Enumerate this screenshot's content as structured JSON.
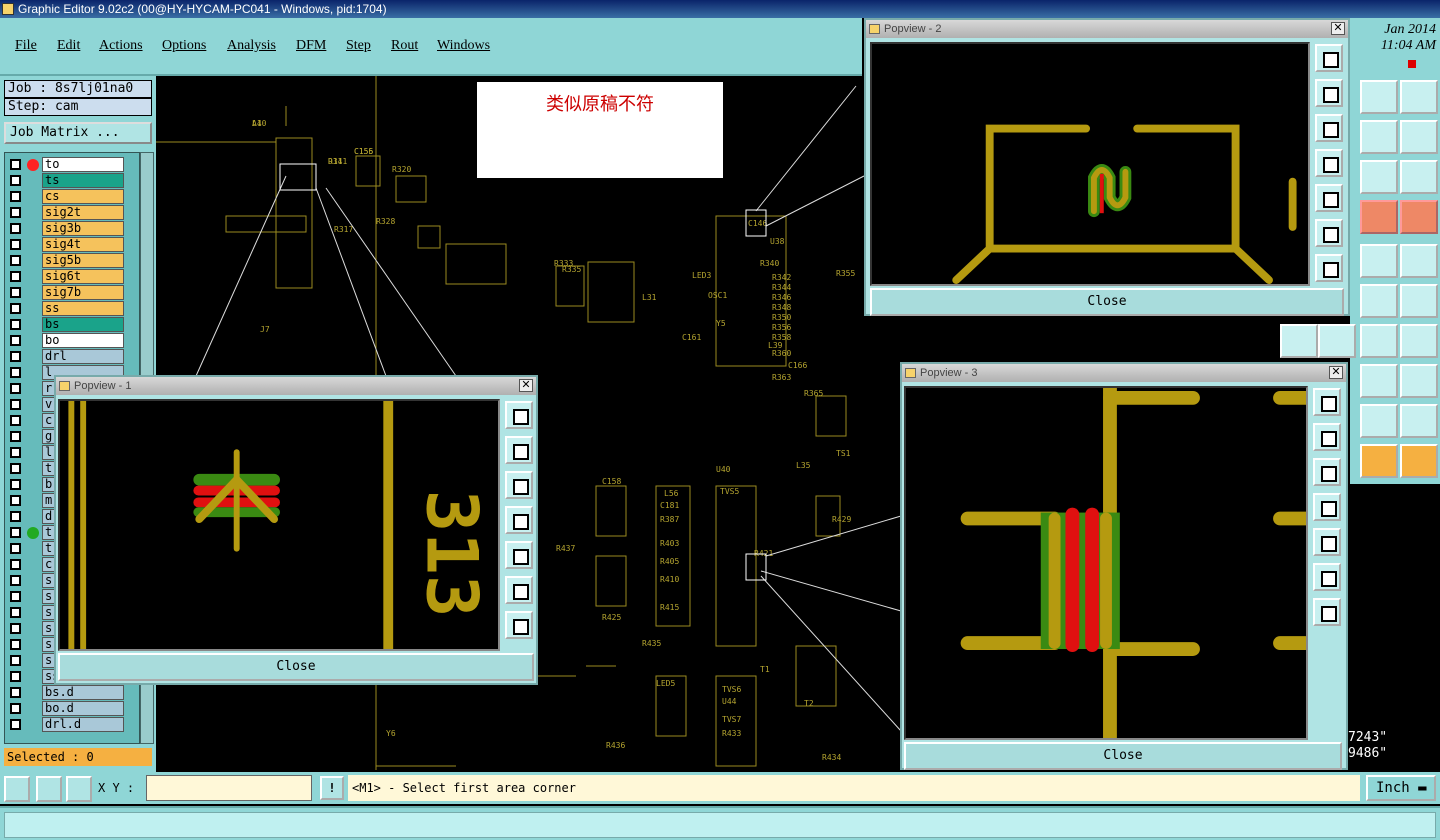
{
  "window": {
    "title": "Graphic Editor 9.02c2 (00@HY-HYCAM-PC041 - Windows, pid:1704)"
  },
  "menu": [
    "File",
    "Edit",
    "Actions",
    "Options",
    "Analysis",
    "DFM",
    "Step",
    "Rout",
    "Windows"
  ],
  "clock": {
    "date": "Jan 2014",
    "time": "11:04 AM"
  },
  "job": {
    "job_label": "Job : 8s7lj01na0",
    "step_label": "Step: cam",
    "matrix_button": "Job Matrix ..."
  },
  "layers": [
    {
      "name": "to",
      "color": "#ffffff",
      "dot": "#ff2222"
    },
    {
      "name": "ts",
      "color": "#1aa38a",
      "dot": ""
    },
    {
      "name": "cs",
      "color": "#f5c25c",
      "dot": ""
    },
    {
      "name": "sig2t",
      "color": "#f5c25c",
      "dot": ""
    },
    {
      "name": "sig3b",
      "color": "#f5c25c",
      "dot": ""
    },
    {
      "name": "sig4t",
      "color": "#f5c25c",
      "dot": ""
    },
    {
      "name": "sig5b",
      "color": "#f5c25c",
      "dot": ""
    },
    {
      "name": "sig6t",
      "color": "#f5c25c",
      "dot": ""
    },
    {
      "name": "sig7b",
      "color": "#f5c25c",
      "dot": ""
    },
    {
      "name": "ss",
      "color": "#f5c25c",
      "dot": ""
    },
    {
      "name": "bs",
      "color": "#1aa38a",
      "dot": ""
    },
    {
      "name": "bo",
      "color": "#ffffff",
      "dot": ""
    },
    {
      "name": "drl",
      "color": "#a9c8d8",
      "dot": ""
    },
    {
      "name": "l",
      "color": "#a9c8d8",
      "dot": ""
    },
    {
      "name": "r",
      "color": "#a9c8d8",
      "dot": ""
    },
    {
      "name": "v",
      "color": "#a9c8d8",
      "dot": ""
    },
    {
      "name": "c",
      "color": "#a9c8d8",
      "dot": ""
    },
    {
      "name": "g",
      "color": "#a9c8d8",
      "dot": ""
    },
    {
      "name": "l",
      "color": "#a9c8d8",
      "dot": ""
    },
    {
      "name": "t",
      "color": "#a9c8d8",
      "dot": ""
    },
    {
      "name": "b",
      "color": "#a9c8d8",
      "dot": ""
    },
    {
      "name": "m",
      "color": "#a9c8d8",
      "dot": ""
    },
    {
      "name": "d",
      "color": "#a9c8d8",
      "dot": ""
    },
    {
      "name": "t",
      "color": "#a9c8d8",
      "dot": "#22aa22"
    },
    {
      "name": "t",
      "color": "#a9c8d8",
      "dot": ""
    },
    {
      "name": "c",
      "color": "#a9c8d8",
      "dot": ""
    },
    {
      "name": "s",
      "color": "#a9c8d8",
      "dot": ""
    },
    {
      "name": "s",
      "color": "#a9c8d8",
      "dot": ""
    },
    {
      "name": "s",
      "color": "#a9c8d8",
      "dot": ""
    },
    {
      "name": "s",
      "color": "#a9c8d8",
      "dot": ""
    },
    {
      "name": "s",
      "color": "#a9c8d8",
      "dot": ""
    },
    {
      "name": "s",
      "color": "#a9c8d8",
      "dot": ""
    },
    {
      "name": "ss.d",
      "color": "#a9c8d8",
      "dot": ""
    },
    {
      "name": "bs.d",
      "color": "#a9c8d8",
      "dot": ""
    },
    {
      "name": "bo.d",
      "color": "#a9c8d8",
      "dot": ""
    },
    {
      "name": "drl.d",
      "color": "#a9c8d8",
      "dot": ""
    }
  ],
  "selected": "Selected : 0",
  "stamp": "类似原稿不符",
  "popviews": {
    "p1": {
      "title": "Popview - 1",
      "close": "Close",
      "silk_text": "313 L"
    },
    "p2": {
      "title": "Popview - 2",
      "close": "Close"
    },
    "p3": {
      "title": "Popview - 3",
      "close": "Close"
    }
  },
  "bottom": {
    "xy_label": "X Y :",
    "xy_value": "",
    "excl": "!",
    "prompt": "<M1> - Select first area corner",
    "units": "Inch"
  },
  "coords": {
    "line1": "7243\"",
    "line2": "9486\""
  },
  "pcb_labels": [
    "A1",
    "R311",
    "C155",
    "R317",
    "R320",
    "R328",
    "R333",
    "R335",
    "LED3",
    "OSC1",
    "L31",
    "C146",
    "U38",
    "R355",
    "Y5",
    "C161",
    "R340",
    "R342",
    "R344",
    "R346",
    "R348",
    "R350",
    "R356",
    "R358",
    "R360",
    "R363",
    "C166",
    "R365",
    "TS1",
    "L35",
    "C158",
    "U40",
    "TVS5",
    "L56",
    "C181",
    "R387",
    "R403",
    "R405",
    "R410",
    "R415",
    "R421",
    "R425",
    "R429",
    "LED5",
    "TVS6",
    "U44",
    "TVS7",
    "R433",
    "R434",
    "R435",
    "R437",
    "R436",
    "Y6",
    "T1",
    "T2",
    "J7",
    "L39",
    "L40",
    "D14",
    "C156"
  ],
  "colors": {
    "copper": "#b59a10",
    "mask": "#3a8a12",
    "pad": "#e01010",
    "silk": "#9a8a20"
  }
}
